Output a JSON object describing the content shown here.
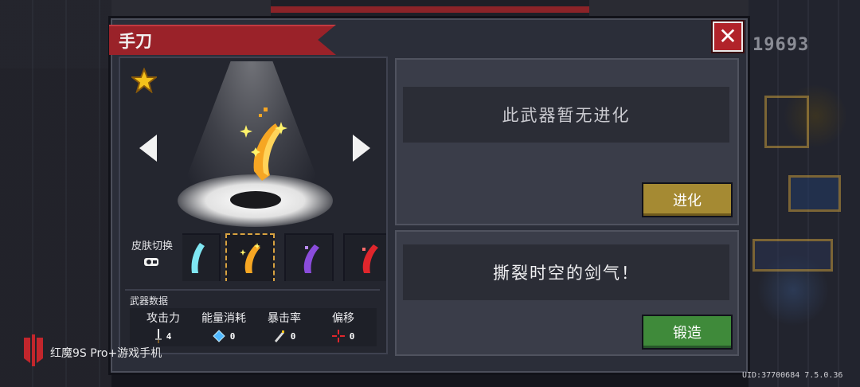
{
  "background": {
    "score": "19693"
  },
  "dialog": {
    "title": "手刀",
    "close_label": "✕",
    "evolution_text": "此武器暂无进化",
    "evolve_button": "进化",
    "description": "撕裂时空的剑气！",
    "forge_button": "锻造",
    "skin_switch_label": "皮肤切换",
    "stats_title": "武器数据",
    "stats": [
      {
        "label": "攻击力",
        "value": "4",
        "icon": "sword-icon"
      },
      {
        "label": "能量消耗",
        "value": "0",
        "icon": "energy-crystal-icon"
      },
      {
        "label": "暴击率",
        "value": "0",
        "icon": "crit-icon"
      },
      {
        "label": "偏移",
        "value": "0",
        "icon": "crosshair-icon"
      }
    ],
    "skins": [
      "cyan-slash",
      "gold-slash",
      "purple-slash",
      "red-slash"
    ],
    "selected_skin": "gold-slash"
  },
  "watermark": {
    "brand_text": "红魔9S Pro+游戏手机",
    "uid": "UID:37700684 7.5.0.36"
  },
  "colors": {
    "title_ribbon": "#9a2229",
    "close_button": "#b1232a",
    "evolve_button": "#a58a33",
    "forge_button": "#3f8a3a",
    "selection_border": "#d8a240"
  }
}
